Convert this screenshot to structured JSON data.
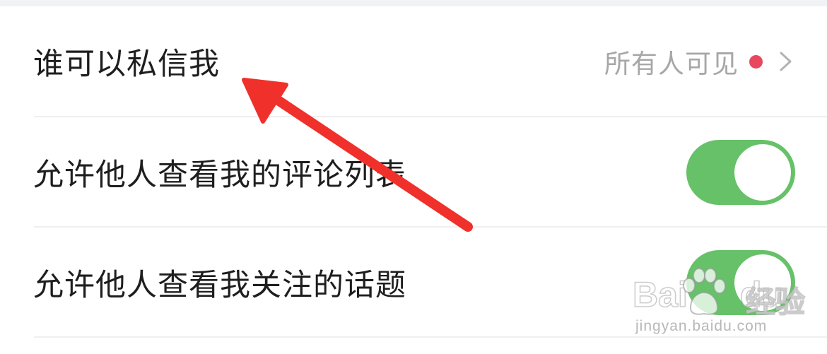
{
  "settings": {
    "rows": [
      {
        "label": "谁可以私信我",
        "value": "所有人可见",
        "has_red_dot": true
      },
      {
        "label": "允许他人查看我的评论列表",
        "toggle_on": true
      },
      {
        "label": "允许他人查看我关注的话题",
        "toggle_on": true
      }
    ]
  },
  "watermark": {
    "brand_prefix": "Bai",
    "brand_suffix": "du",
    "brand_cn": "经验",
    "url": "jingyan.baidu.com"
  },
  "colors": {
    "toggle_on": "#66c169",
    "red_dot": "#e8475e",
    "annotation_arrow": "#f0302a",
    "secondary_text": "#a7a7a7",
    "primary_text": "#1e1e1e"
  },
  "icons": {
    "row_chevron": "chevron-right-icon",
    "annotation": "red-arrow-annotation",
    "watermark_logo": "baidu-paw-icon"
  }
}
